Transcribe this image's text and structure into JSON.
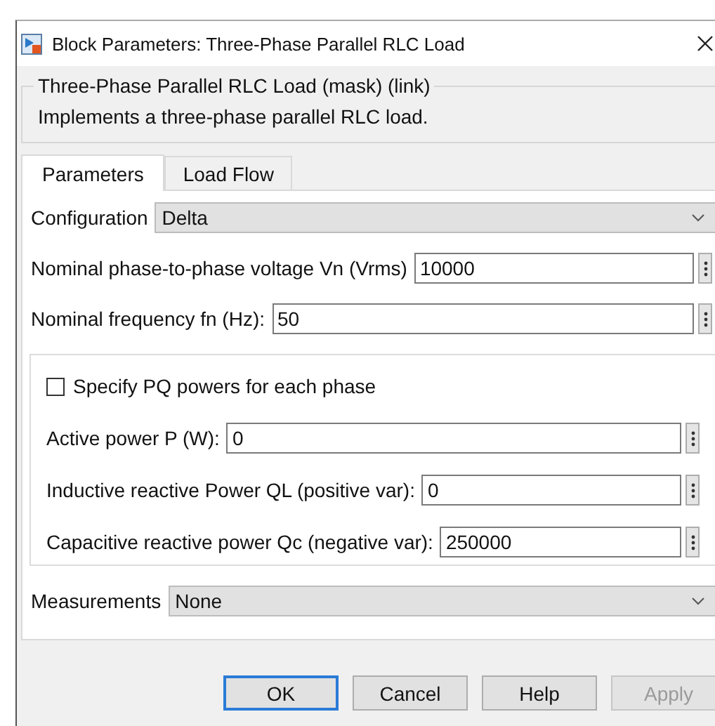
{
  "window": {
    "title": "Block Parameters: Three-Phase Parallel RLC Load"
  },
  "mask": {
    "title": "Three-Phase Parallel RLC Load (mask) (link)",
    "description": "Implements a three-phase parallel RLC load."
  },
  "tabs": [
    {
      "label": "Parameters",
      "selected": true
    },
    {
      "label": "Load Flow",
      "selected": false
    }
  ],
  "parameters": [
    {
      "kind": "dropdown",
      "label": "Configuration",
      "value": "Delta"
    },
    {
      "kind": "field",
      "label": "Nominal phase-to-phase voltage Vn (Vrms)",
      "value": "10000"
    },
    {
      "kind": "field",
      "label": "Nominal frequency fn (Hz):",
      "value": "50"
    },
    {
      "kind": "group",
      "items": [
        {
          "kind": "checkbox",
          "label": "Specify PQ powers for each phase",
          "checked": false
        },
        {
          "kind": "field",
          "label": "Active power P (W):",
          "value": "0"
        },
        {
          "kind": "field",
          "label": "Inductive reactive Power QL (positive var):",
          "value": "0"
        },
        {
          "kind": "field",
          "label": "Capacitive reactive power Qc (negative var):",
          "value": "250000"
        }
      ]
    },
    {
      "kind": "dropdown",
      "label": "Measurements",
      "value": "None"
    }
  ],
  "buttons": [
    {
      "label": "OK",
      "disabled": false,
      "default": true
    },
    {
      "label": "Cancel",
      "disabled": false,
      "default": false
    },
    {
      "label": "Help",
      "disabled": false,
      "default": false
    },
    {
      "label": "Apply",
      "disabled": true,
      "default": false
    }
  ]
}
